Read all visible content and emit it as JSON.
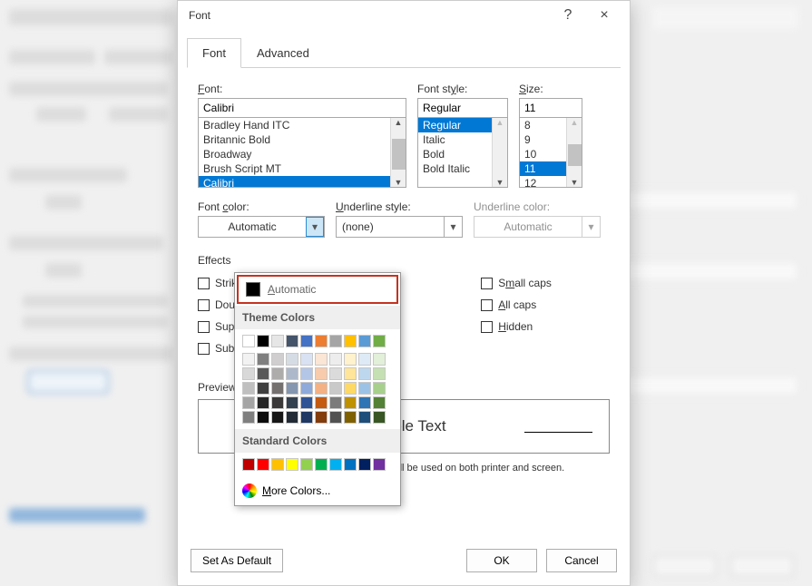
{
  "dialog": {
    "title": "Font",
    "help": "?",
    "close": "×",
    "tabs": {
      "font": "Font",
      "advanced": "Advanced"
    },
    "labels": {
      "font": "Font:",
      "font_u": "F",
      "fontstyle": "Font style:",
      "fontstyle_u": "y",
      "size": "Size:",
      "size_u": "S",
      "fontcolor": "Font color:",
      "fontcolor_u": "c",
      "underlinestyle": "Underline style:",
      "underlinestyle_u": "U",
      "underlinecolor": "Underline color:",
      "underlinecolor_u": "I",
      "effects": "Effects",
      "preview": "Preview"
    },
    "font_value": "Calibri",
    "font_list": [
      "Bradley Hand ITC",
      "Britannic Bold",
      "Broadway",
      "Brush Script MT",
      "Calibri"
    ],
    "font_list_selected": "Calibri",
    "style_value": "Regular",
    "style_list": [
      "Regular",
      "Italic",
      "Bold",
      "Bold Italic"
    ],
    "style_list_selected": "Regular",
    "size_value": "11",
    "size_list": [
      "8",
      "9",
      "10",
      "11",
      "12"
    ],
    "size_list_selected": "11",
    "font_color_value": "Automatic",
    "underline_style_value": "(none)",
    "underline_color_value": "Automatic",
    "effects": {
      "strike": "Strikethrough",
      "dstrike": "Double strikethrough",
      "superscript": "Superscript",
      "subscript": "Subscript",
      "smallcaps": "Small caps",
      "smallcaps_u": "m",
      "allcaps": "All caps",
      "allcaps_u": "A",
      "hidden": "Hidden",
      "hidden_u": "H"
    },
    "preview_text": "Sample Text",
    "hint": "This is a TrueType font. This font will be used on both printer and screen.",
    "set_default": "Set As Default",
    "ok": "OK",
    "cancel": "Cancel"
  },
  "color_popup": {
    "automatic": "Automatic",
    "automatic_u": "A",
    "theme_head": "Theme Colors",
    "theme_colors_row": [
      "#FFFFFF",
      "#000000",
      "#E7E6E6",
      "#44546A",
      "#4472C4",
      "#ED7D31",
      "#A5A5A5",
      "#FFC000",
      "#5B9BD5",
      "#70AD47"
    ],
    "theme_tints": [
      [
        "#F2F2F2",
        "#7F7F7F",
        "#D0CECE",
        "#D6DCE4",
        "#D9E2F3",
        "#FBE5D5",
        "#EDEDED",
        "#FFF2CC",
        "#DEEBF6",
        "#E2EFD9"
      ],
      [
        "#D8D8D8",
        "#595959",
        "#AEABAB",
        "#ADB9CA",
        "#B4C6E7",
        "#F7CBAC",
        "#DBDBDB",
        "#FEE599",
        "#BDD7EE",
        "#C5E0B3"
      ],
      [
        "#BFBFBF",
        "#3F3F3F",
        "#757070",
        "#8496B0",
        "#8EAADB",
        "#F4B183",
        "#C9C9C9",
        "#FFD965",
        "#9CC3E5",
        "#A8D08D"
      ],
      [
        "#A5A5A5",
        "#262626",
        "#3A3838",
        "#323F4F",
        "#2F5496",
        "#C55A11",
        "#7B7B7B",
        "#BF9000",
        "#2E75B5",
        "#538135"
      ],
      [
        "#7F7F7F",
        "#0C0C0C",
        "#171616",
        "#222A35",
        "#1F3864",
        "#833C0B",
        "#525252",
        "#7F6000",
        "#1E4E79",
        "#375623"
      ]
    ],
    "standard_head": "Standard Colors",
    "standard_colors": [
      "#C00000",
      "#FF0000",
      "#FFC000",
      "#FFFF00",
      "#92D050",
      "#00B050",
      "#00B0F0",
      "#0070C0",
      "#002060",
      "#7030A0"
    ],
    "more": "More Colors...",
    "more_u": "M"
  }
}
